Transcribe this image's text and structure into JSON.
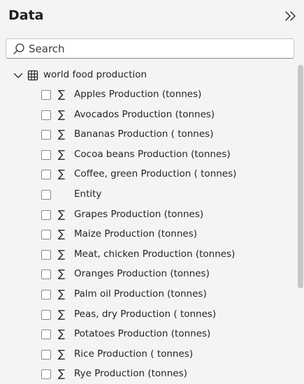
{
  "header": {
    "title": "Data",
    "collapse_icon": "double-chevron-right-icon"
  },
  "search": {
    "placeholder": "Search",
    "value": "",
    "icon": "search-icon"
  },
  "tree": {
    "table": {
      "name": "world food production",
      "icon": "table-icon",
      "expanded": true
    },
    "fields": [
      {
        "label": "Apples Production (tonnes)",
        "icon": "sigma-icon",
        "checked": false
      },
      {
        "label": "Avocados Production (tonnes)",
        "icon": "sigma-icon",
        "checked": false
      },
      {
        "label": "Bananas Production ( tonnes)",
        "icon": "sigma-icon",
        "checked": false
      },
      {
        "label": "Cocoa beans Production (tonnes)",
        "icon": "sigma-icon",
        "checked": false
      },
      {
        "label": "Coffee, green Production ( tonnes)",
        "icon": "sigma-icon",
        "checked": false
      },
      {
        "label": "Entity",
        "icon": "",
        "checked": false
      },
      {
        "label": "Grapes Production (tonnes)",
        "icon": "sigma-icon",
        "checked": false
      },
      {
        "label": "Maize Production (tonnes)",
        "icon": "sigma-icon",
        "checked": false
      },
      {
        "label": "Meat, chicken Production (tonnes)",
        "icon": "sigma-icon",
        "checked": false
      },
      {
        "label": "Oranges Production (tonnes)",
        "icon": "sigma-icon",
        "checked": false
      },
      {
        "label": "Palm oil Production (tonnes)",
        "icon": "sigma-icon",
        "checked": false
      },
      {
        "label": "Peas, dry Production ( tonnes)",
        "icon": "sigma-icon",
        "checked": false
      },
      {
        "label": "Potatoes Production (tonnes)",
        "icon": "sigma-icon",
        "checked": false
      },
      {
        "label": "Rice Production ( tonnes)",
        "icon": "sigma-icon",
        "checked": false
      },
      {
        "label": "Rye Production (tonnes)",
        "icon": "sigma-icon",
        "checked": false
      }
    ]
  },
  "colors": {
    "background": "#f4f4f4",
    "text": "#252423",
    "scroll_thumb": "#c8c6c4"
  }
}
